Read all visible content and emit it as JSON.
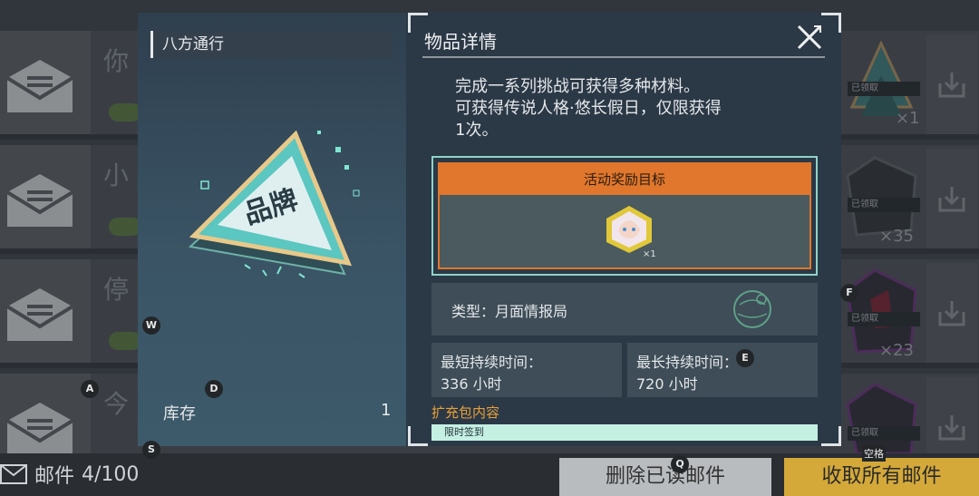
{
  "mail_list": {
    "rows": [
      {
        "title": "你",
        "claimed": "已领取",
        "qty": "×1"
      },
      {
        "title": "小",
        "claimed": "已领取",
        "qty": "×35"
      },
      {
        "title": "停",
        "claimed": "已领取",
        "qty": "×23"
      },
      {
        "title": "今",
        "claimed": "已领取",
        "qty": ""
      }
    ]
  },
  "bottom": {
    "mail_label": "邮件",
    "mail_count": "4/100",
    "delete_read": "删除已读邮件",
    "collect_all": "收取所有邮件"
  },
  "item": {
    "name": "八方通行",
    "stock_label": "库存",
    "stock_value": "1",
    "art_text": "品牌"
  },
  "detail": {
    "title": "物品详情",
    "description_line1": "完成一系列挑战可获得多种材料。",
    "description_line2": "可获得传说人格·悠长假日，仅限获得",
    "description_line3": "1次。",
    "reward_header": "活动奖励目标",
    "reward_qty": "×1",
    "type_text": "类型：月面情报局",
    "min_duration_label": "最短持续时间：",
    "min_duration_value": "336 小时",
    "max_duration_label": "最长持续时间：",
    "max_duration_value": "720 小时",
    "expansion_label": "扩充包内容",
    "expansion_item": "限时签到"
  },
  "key_hints": {
    "w": "W",
    "a": "A",
    "d": "D",
    "s": "S",
    "e": "E",
    "f": "F",
    "q": "Q",
    "space": "空格"
  },
  "colors": {
    "accent_orange": "#e0772c",
    "accent_teal": "#8fd3c8",
    "collect_gold": "#d4a93a",
    "expansion_label": "#e6a03a"
  }
}
